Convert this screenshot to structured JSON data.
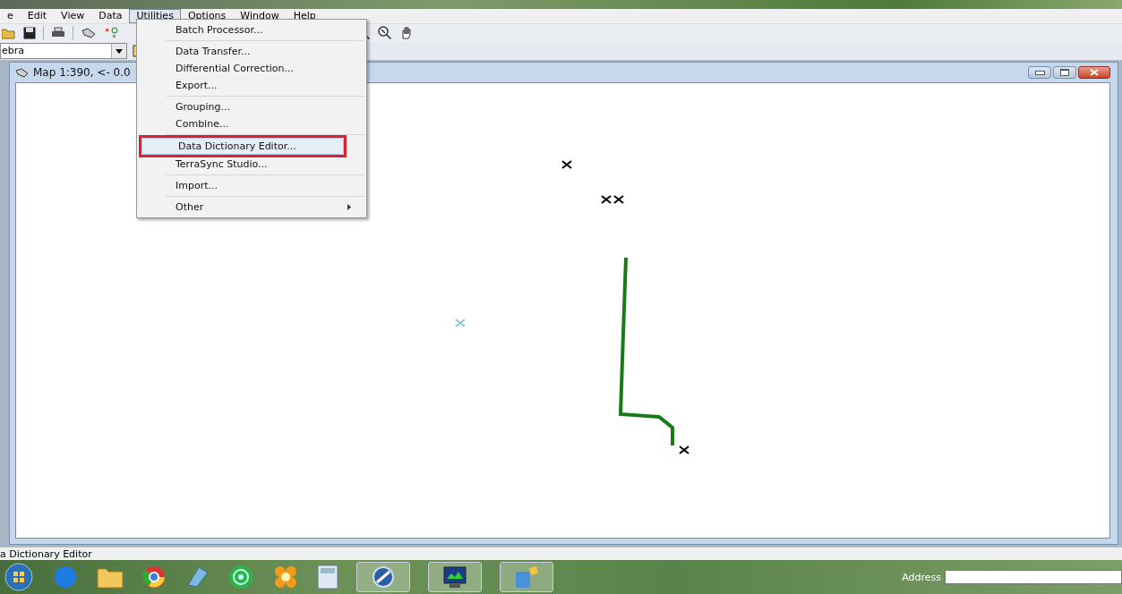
{
  "menu_bar": [
    {
      "label": "e",
      "selected": false
    },
    {
      "label": "Edit",
      "selected": false
    },
    {
      "label": "View",
      "selected": false
    },
    {
      "label": "Data",
      "selected": false
    },
    {
      "label": "Utilities",
      "selected": true
    },
    {
      "label": "Options",
      "selected": false
    },
    {
      "label": "Window",
      "selected": false
    },
    {
      "label": "Help",
      "selected": false
    }
  ],
  "utilities_menu": [
    {
      "kind": "item",
      "label": "Batch Processor...",
      "highlighted": false,
      "annotated": false,
      "submenu": false
    },
    {
      "kind": "separator"
    },
    {
      "kind": "item",
      "label": "Data Transfer...",
      "highlighted": false,
      "annotated": false,
      "submenu": false
    },
    {
      "kind": "item",
      "label": "Differential Correction...",
      "highlighted": false,
      "annotated": false,
      "submenu": false
    },
    {
      "kind": "item",
      "label": "Export...",
      "highlighted": false,
      "annotated": false,
      "submenu": false
    },
    {
      "kind": "separator"
    },
    {
      "kind": "item",
      "label": "Grouping...",
      "highlighted": false,
      "annotated": false,
      "submenu": false
    },
    {
      "kind": "item",
      "label": "Combine...",
      "highlighted": false,
      "annotated": false,
      "submenu": false
    },
    {
      "kind": "separator"
    },
    {
      "kind": "item",
      "label": "Data Dictionary Editor...",
      "highlighted": true,
      "annotated": true,
      "submenu": false
    },
    {
      "kind": "item",
      "label": "TerraSync Studio...",
      "highlighted": false,
      "annotated": false,
      "submenu": false
    },
    {
      "kind": "separator"
    },
    {
      "kind": "item",
      "label": "Import...",
      "highlighted": false,
      "annotated": false,
      "submenu": false
    },
    {
      "kind": "separator"
    },
    {
      "kind": "item",
      "label": "Other",
      "highlighted": false,
      "annotated": false,
      "submenu": true
    }
  ],
  "combo": {
    "value": "ebra"
  },
  "map_window": {
    "title": "Map 1:390, <- 0.0",
    "markers": [
      {
        "color": "#000000"
      },
      {
        "color": "#000000"
      },
      {
        "color": "#000000"
      },
      {
        "color": "#8fc4d8"
      },
      {
        "color": "#000000"
      }
    ]
  },
  "status_bar": {
    "text": "a Dictionary Editor"
  },
  "taskbar": {
    "address_label": "Address"
  }
}
